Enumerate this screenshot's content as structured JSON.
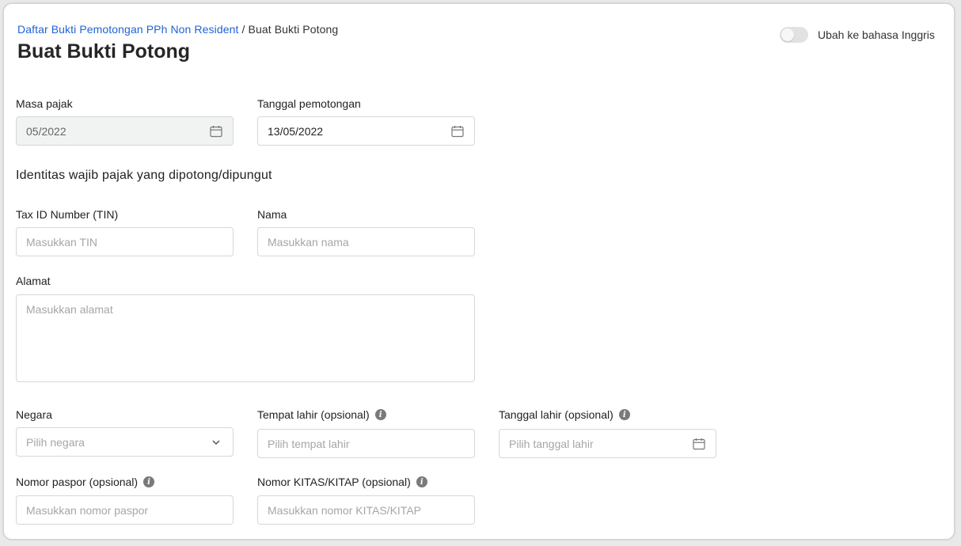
{
  "breadcrumb": {
    "parent": "Daftar Bukti Pemotongan PPh Non Resident",
    "separator": "/",
    "current": "Buat Bukti Potong"
  },
  "page_title": "Buat Bukti Potong",
  "language_toggle": {
    "label": "Ubah ke bahasa Inggris",
    "on": false
  },
  "masa_pajak": {
    "label": "Masa pajak",
    "value": "05/2022",
    "icon": "calendar-icon"
  },
  "tanggal_pemotongan": {
    "label": "Tanggal pemotongan",
    "value": "13/05/2022",
    "icon": "calendar-icon"
  },
  "section_identitas": "Identitas wajib pajak yang dipotong/dipungut",
  "tin": {
    "label": "Tax ID Number (TIN)",
    "placeholder": "Masukkan TIN"
  },
  "nama": {
    "label": "Nama",
    "placeholder": "Masukkan nama"
  },
  "alamat": {
    "label": "Alamat",
    "placeholder": "Masukkan alamat"
  },
  "negara": {
    "label": "Negara",
    "placeholder": "Pilih negara",
    "icon": "chevron-down-icon"
  },
  "tempat_lahir": {
    "label": "Tempat lahir (opsional)",
    "placeholder": "Pilih tempat lahir",
    "info_icon": "info-icon"
  },
  "tanggal_lahir": {
    "label": "Tanggal lahir (opsional)",
    "placeholder": "Pilih tanggal lahir",
    "info_icon": "info-icon",
    "icon": "calendar-icon"
  },
  "paspor": {
    "label": "Nomor paspor (opsional)",
    "placeholder": "Masukkan nomor paspor",
    "info_icon": "info-icon"
  },
  "kitas": {
    "label": "Nomor KITAS/KITAP (opsional)",
    "placeholder": "Masukkan nomor KITAS/KITAP",
    "info_icon": "info-icon"
  },
  "colors": {
    "link": "#1f63d6",
    "border": "#d7d7d7",
    "disabled_bg": "#f1f2f2",
    "placeholder": "#a6a6a6"
  }
}
